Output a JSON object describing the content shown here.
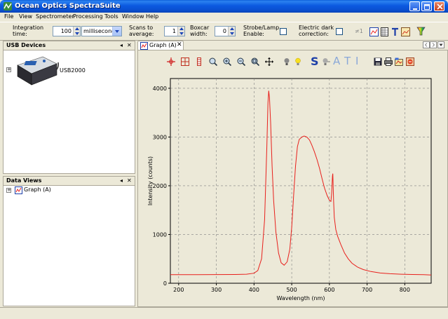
{
  "window": {
    "title": "Ocean Optics SpectraSuite"
  },
  "menu": [
    "File",
    "View",
    "Spectrometer",
    "Processing",
    "Tools",
    "Window",
    "Help"
  ],
  "toolbar": {
    "integration_label_1": "Integration",
    "integration_label_2": "time:",
    "integration_value": "100",
    "integration_units": "milliseconds",
    "scans_label_1": "Scans to",
    "scans_label_2": "average:",
    "scans_value": "1",
    "boxcar_label_1": "Boxcar",
    "boxcar_label_2": "width:",
    "boxcar_value": "0",
    "strobe_label_1": "Strobe/Lamp",
    "strobe_label_2": "Enable:",
    "strobe_checked": false,
    "dark_label_1": "Electric dark",
    "dark_label_2": "correction:",
    "dark_checked": false,
    "nonlinear_label": "≠1"
  },
  "usb_panel": {
    "title": "USB Devices",
    "pin": "◂",
    "close": "✕",
    "device_name": "USB2000"
  },
  "data_panel": {
    "title": "Data Views",
    "pin": "◂",
    "close": "✕",
    "item": "Graph (A)"
  },
  "graph_tab": {
    "label": "Graph (A)",
    "close": "✕"
  },
  "graph_toolbar": {
    "text_tools": [
      "S",
      "A",
      "T",
      "I"
    ]
  },
  "colors": {
    "trace": "#e8201c",
    "titlebar": "#0a5cd8",
    "grid": "#808080"
  },
  "chart_data": {
    "type": "line",
    "xlabel": "Wavelength (nm)",
    "ylabel": "Intensity (counts)",
    "xlim": [
      178,
      870
    ],
    "ylim": [
      0,
      4200
    ],
    "xticks": [
      200,
      300,
      400,
      500,
      600,
      700,
      800
    ],
    "yticks": [
      0,
      1000,
      2000,
      3000,
      4000
    ],
    "grid": true,
    "series": [
      {
        "x": [
          178,
          250,
          300,
          350,
          380,
          400,
          410,
          420,
          428,
          434,
          437,
          439,
          441,
          444,
          448,
          452,
          458,
          465,
          472,
          480,
          488,
          495,
          500,
          505,
          510,
          515,
          520,
          527,
          533,
          540,
          547,
          553,
          560,
          567,
          574,
          580,
          587,
          594,
          600,
          604,
          606,
          608,
          609,
          611,
          613,
          617,
          622,
          630,
          640,
          650,
          660,
          675,
          690,
          710,
          735,
          760,
          790,
          820,
          850,
          870
        ],
        "y": [
          175,
          175,
          178,
          180,
          185,
          205,
          260,
          500,
          1300,
          2800,
          3700,
          3950,
          3800,
          3300,
          2400,
          1700,
          1050,
          620,
          420,
          370,
          440,
          700,
          1150,
          1800,
          2400,
          2800,
          2950,
          3000,
          3020,
          3000,
          2940,
          2840,
          2700,
          2540,
          2350,
          2160,
          1950,
          1800,
          1700,
          1680,
          1850,
          2200,
          2250,
          1700,
          1350,
          1100,
          960,
          800,
          620,
          500,
          410,
          330,
          280,
          240,
          210,
          195,
          185,
          180,
          175,
          170
        ]
      }
    ]
  }
}
